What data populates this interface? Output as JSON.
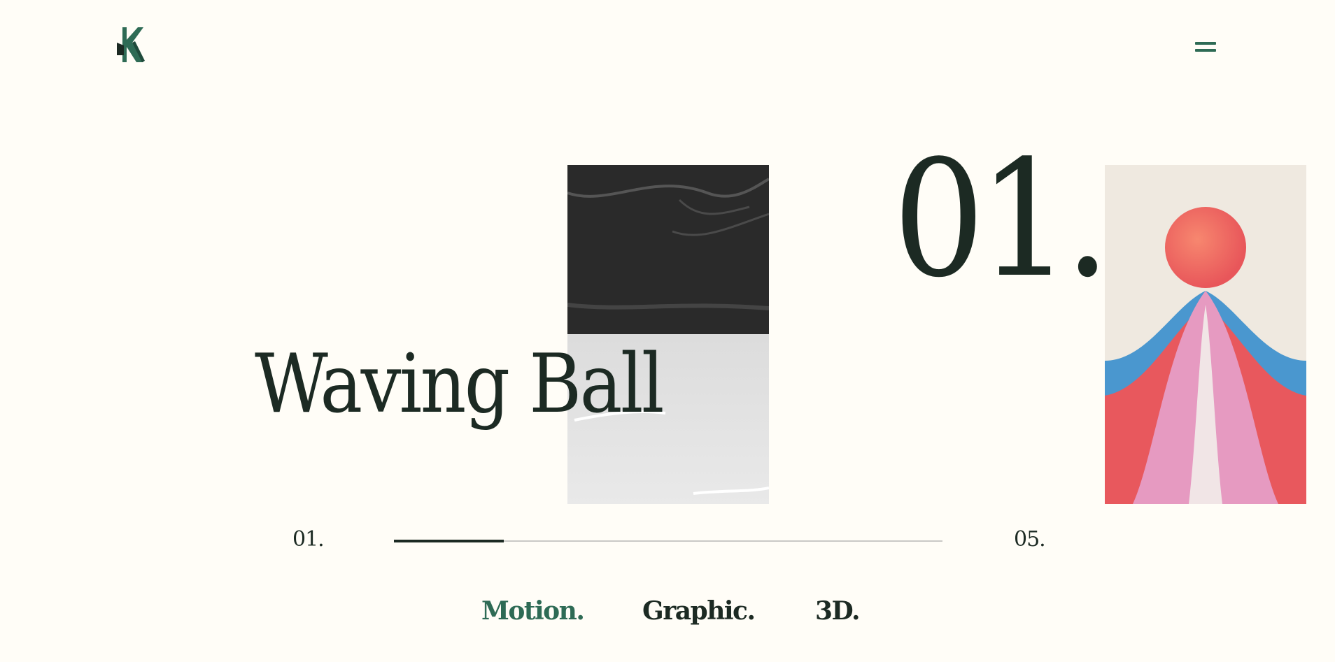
{
  "header": {
    "logo_icon": "brand-logo-icon",
    "menu_icon": "hamburger-menu-icon"
  },
  "colors": {
    "background": "#fffdf7",
    "accent": "#2e6b55",
    "text": "#1c2a23"
  },
  "slider": {
    "current_number": "01.",
    "title": "Waving Ball",
    "start_label": "01.",
    "end_label": "05.",
    "progress_fraction": 0.2
  },
  "categories": [
    {
      "label": "Motion.",
      "active": true
    },
    {
      "label": "Graphic.",
      "active": false
    },
    {
      "label": "3D.",
      "active": false
    }
  ]
}
